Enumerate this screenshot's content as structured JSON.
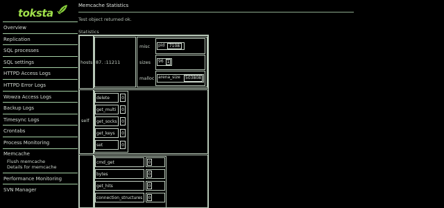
{
  "brand": {
    "name": "toksta"
  },
  "sidebar": {
    "items": [
      {
        "label": "Overview"
      },
      {
        "label": "Replication"
      },
      {
        "label": "SQL processes"
      },
      {
        "label": "SQL settings"
      },
      {
        "label": "HTTPD Access Logs"
      },
      {
        "label": "HTTPD Error Logs"
      },
      {
        "label": "Wowza Access Logs"
      },
      {
        "label": "Backup Logs"
      },
      {
        "label": "Timesync Logs"
      },
      {
        "label": "Crontabs"
      },
      {
        "label": "Process Monitoring"
      }
    ],
    "memcache": {
      "label": "Memcache",
      "sub": [
        "Flush memcache",
        "Details for memcache"
      ]
    },
    "after": [
      {
        "label": "Performance Monitoring"
      },
      {
        "label": "SVN Manager"
      }
    ]
  },
  "main": {
    "title": "Memcache Statistics",
    "status": "Test object returned ok.",
    "section": "Statistics",
    "hosts": {
      "label": "hosts",
      "server": "87.            :11211",
      "misc": {
        "label": "misc",
        "key": "pid",
        "value": "7108"
      },
      "sizes": {
        "label": "sizes",
        "key": "96",
        "value": "1"
      },
      "malloc": {
        "label": "malloc",
        "key": "arena_size",
        "value": "503808"
      }
    },
    "self": {
      "label": "self",
      "rows": [
        {
          "key": "delete",
          "value": "0"
        },
        {
          "key": "get_multi",
          "value": "0"
        },
        {
          "key": "get_socks",
          "value": "0"
        },
        {
          "key": "get_keys",
          "value": "0"
        },
        {
          "key": "set",
          "value": "0"
        }
      ]
    },
    "total": {
      "rows": [
        {
          "key": "cmd_get",
          "value": "0"
        },
        {
          "key": "bytes",
          "value": "0"
        },
        {
          "key": "get_hits",
          "value": "0"
        },
        {
          "key": "connection_structures",
          "value": "0"
        }
      ]
    }
  },
  "colors": {
    "background": "#000000",
    "text": "#c8d2c8",
    "border": "#b9c9b9",
    "logo": "#9fe04a"
  }
}
